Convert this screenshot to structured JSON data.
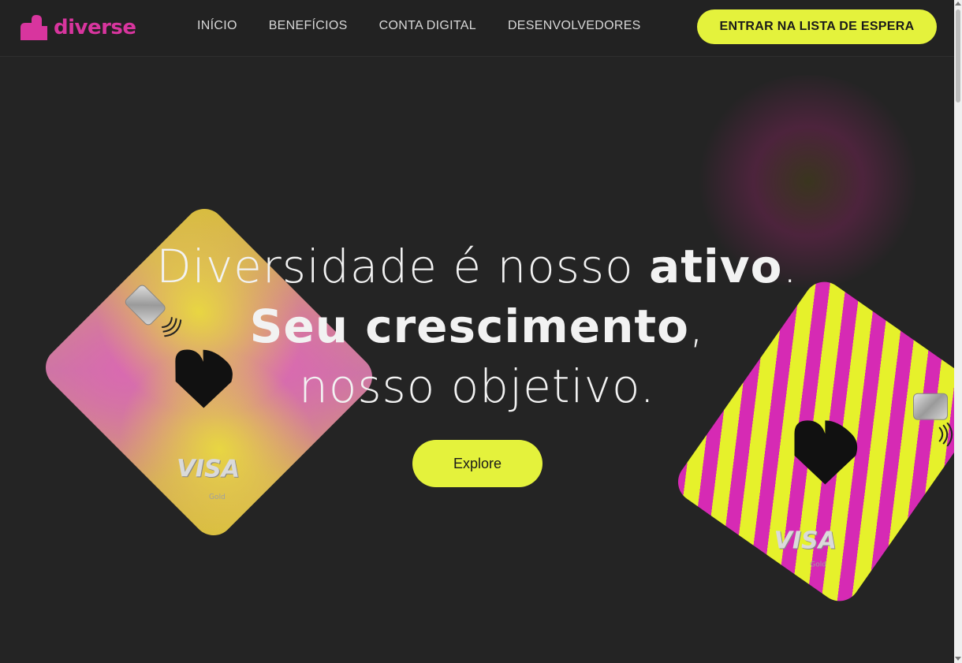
{
  "brand": {
    "name": "diverse",
    "color": "#d8359e",
    "accent": "#e4f23c"
  },
  "nav": {
    "items": [
      {
        "label": "INÍCIO"
      },
      {
        "label": "BENEFÍCIOS"
      },
      {
        "label": "CONTA DIGITAL"
      },
      {
        "label": "DESENVOLVEDORES"
      }
    ],
    "cta_label": "ENTRAR NA LISTA DE ESPERA"
  },
  "hero": {
    "line1_light": "Diversidade é nosso ",
    "line1_bold": "ativo",
    "line1_end": ".",
    "line2_bold": "Seu crescimento",
    "line2_end": ",",
    "line3": "nosso objetivo.",
    "button_label": "Explore"
  },
  "cards": {
    "gold": {
      "network": "VISA",
      "tier": "Gold"
    },
    "zebra": {
      "network": "VISA",
      "tier": "Gold"
    }
  },
  "icons": [
    "diverse-logo-icon",
    "contactless-icon",
    "card-chip-icon",
    "heart-logo-icon"
  ]
}
